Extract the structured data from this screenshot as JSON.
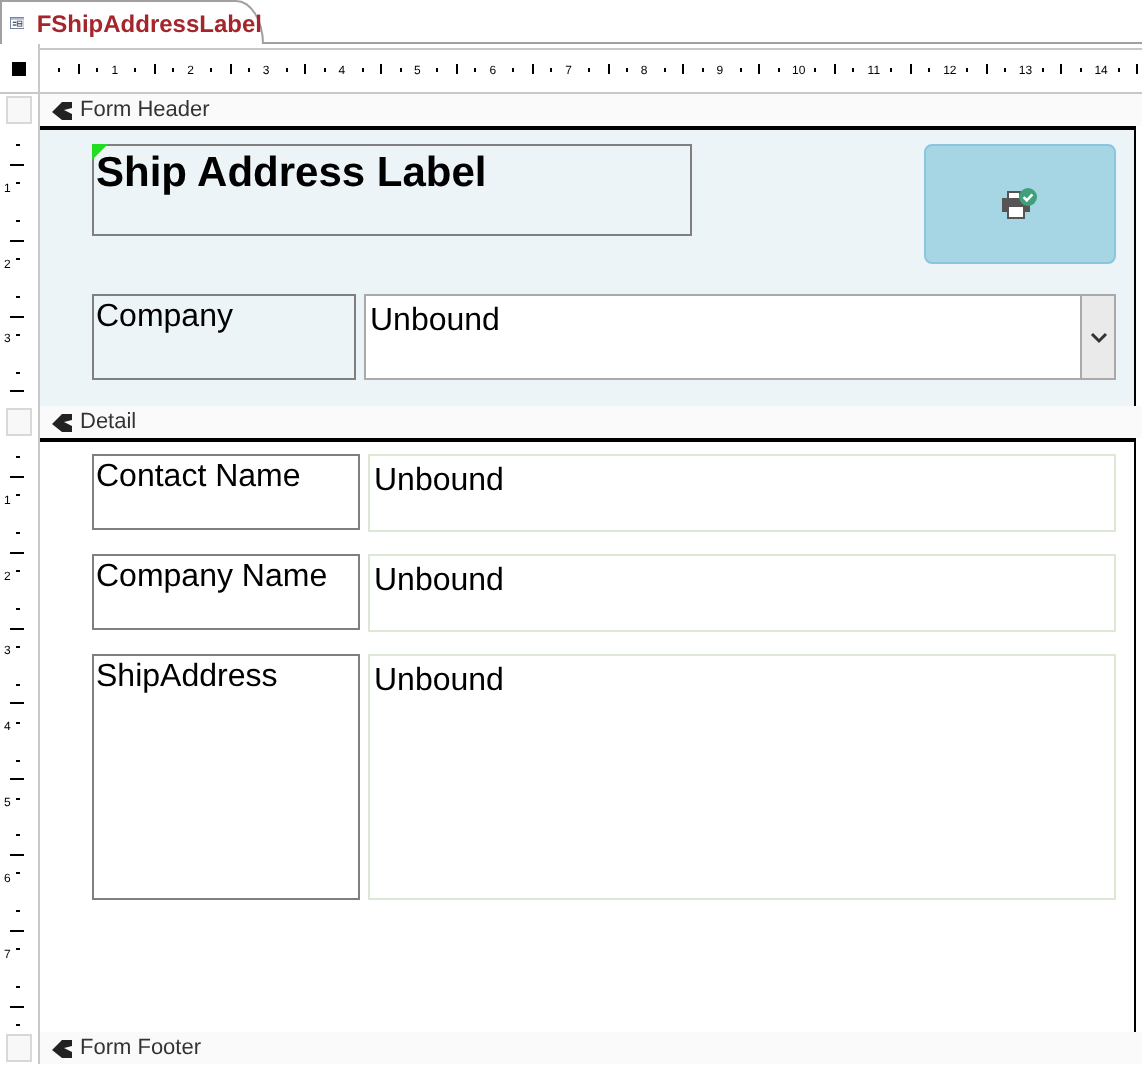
{
  "tab": {
    "title": "FShipAddressLabel",
    "selected": true
  },
  "ruler": {
    "numbers": [
      "1",
      "2",
      "3",
      "4",
      "5",
      "6",
      "7",
      "8",
      "9",
      "10",
      "11",
      "12",
      "13",
      "14"
    ]
  },
  "sections": [
    {
      "kind": "header",
      "title": "Form Header",
      "ruler_numbers": [
        "1",
        "2",
        "3"
      ],
      "controls": [
        {
          "kind": "label",
          "text": "Ship Address Label",
          "bold": true,
          "selected": true
        },
        {
          "kind": "button"
        },
        {
          "kind": "label",
          "text": "Company",
          "bold": false,
          "selected": false
        },
        {
          "kind": "combo",
          "value": "Unbound"
        }
      ]
    },
    {
      "kind": "detail",
      "title": "Detail",
      "ruler_numbers": [
        "1",
        "2",
        "3",
        "4",
        "5",
        "6",
        "7"
      ],
      "controls": [
        {
          "kind": "label",
          "text": "Contact Name",
          "bold": false,
          "selected": false
        },
        {
          "kind": "textbox",
          "value": "Unbound"
        },
        {
          "kind": "label",
          "text": "Company Name",
          "bold": false,
          "selected": false
        },
        {
          "kind": "textbox",
          "value": "Unbound"
        },
        {
          "kind": "label",
          "text": "ShipAddress",
          "bold": false,
          "selected": false
        },
        {
          "kind": "textbox",
          "value": "Unbound"
        }
      ]
    },
    {
      "kind": "footer",
      "title": "Form Footer"
    }
  ]
}
